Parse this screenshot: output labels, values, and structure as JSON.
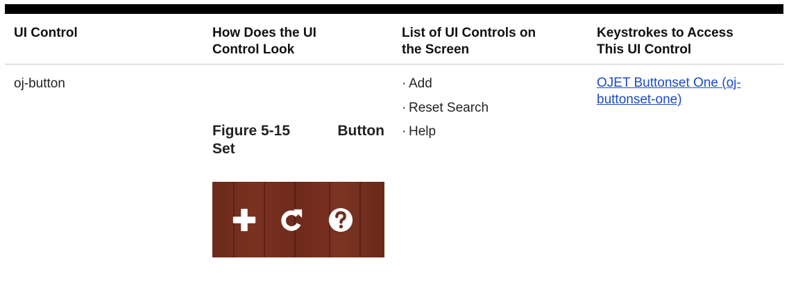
{
  "table": {
    "headers": {
      "col1": "UI Control",
      "col2_line1": "How Does the UI",
      "col2_line2": "Control Look",
      "col3_line1": "List of UI Controls on",
      "col3_line2": "the Screen",
      "col4_line1": "Keystrokes to Access",
      "col4_line2": "This UI Control"
    },
    "row": {
      "control": "oj-button",
      "figure_label": "Figure 5-15",
      "figure_word1": "Button",
      "figure_word2": "Set",
      "controls_list": [
        "Add",
        "Reset Search",
        "Help"
      ],
      "link_line1": "OJET Buttonset One (oj-",
      "link_line2": "buttonset-one)"
    }
  },
  "figure": {
    "icons": [
      "plus-icon",
      "refresh-icon",
      "help-icon"
    ],
    "background_color": "#6e2c1e",
    "icon_color": "#ffffff"
  },
  "colors": {
    "link": "#1a4bc4",
    "rule": "#000000"
  }
}
